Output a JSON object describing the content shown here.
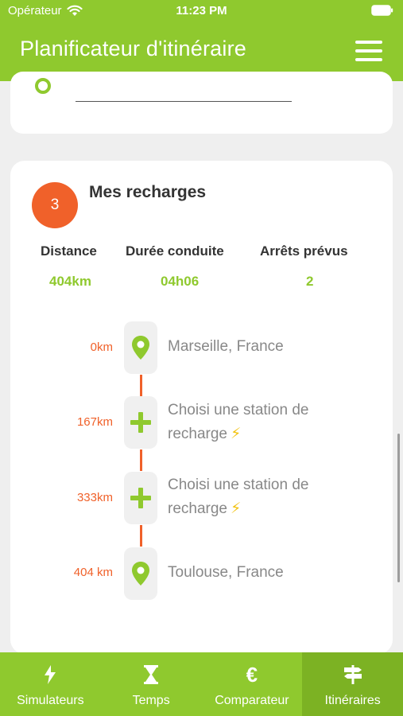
{
  "status_bar": {
    "carrier": "Opérateur",
    "time": "11:23 PM"
  },
  "header": {
    "title": "Planificateur d'itinéraire",
    "menu_icon": "hamburger-menu-icon"
  },
  "section": {
    "step": "3",
    "title": "Mes recharges",
    "stats": [
      {
        "label": "Distance",
        "value": "404km"
      },
      {
        "label": "Durée conduite",
        "value": "04h06"
      },
      {
        "label": "Arrêts prévus",
        "value": "2"
      }
    ],
    "stops": [
      {
        "km": "0km",
        "icon": "map-pin-icon",
        "text_line1": "Marseille, France",
        "text_line2": ""
      },
      {
        "km": "167km",
        "icon": "plus-icon",
        "text_line1": "Choisi une station de",
        "text_line2": "recharge"
      },
      {
        "km": "333km",
        "icon": "plus-icon",
        "text_line1": "Choisi une station de",
        "text_line2": "recharge"
      },
      {
        "km": "404 km",
        "icon": "map-pin-icon",
        "text_line1": "Toulouse, France",
        "text_line2": ""
      }
    ],
    "bolt_glyph": "⚡"
  },
  "tabs": [
    {
      "label": "Simulateurs",
      "icon": "lightning-icon",
      "active": false
    },
    {
      "label": "Temps",
      "icon": "hourglass-icon",
      "active": false
    },
    {
      "label": "Comparateur",
      "icon": "euro-icon",
      "active": false
    },
    {
      "label": "Itinéraires",
      "icon": "signpost-icon",
      "active": true
    }
  ],
  "colors": {
    "brand_green": "#8fc92e",
    "accent_orange": "#f0612a",
    "bolt_yellow": "#f2c313"
  }
}
